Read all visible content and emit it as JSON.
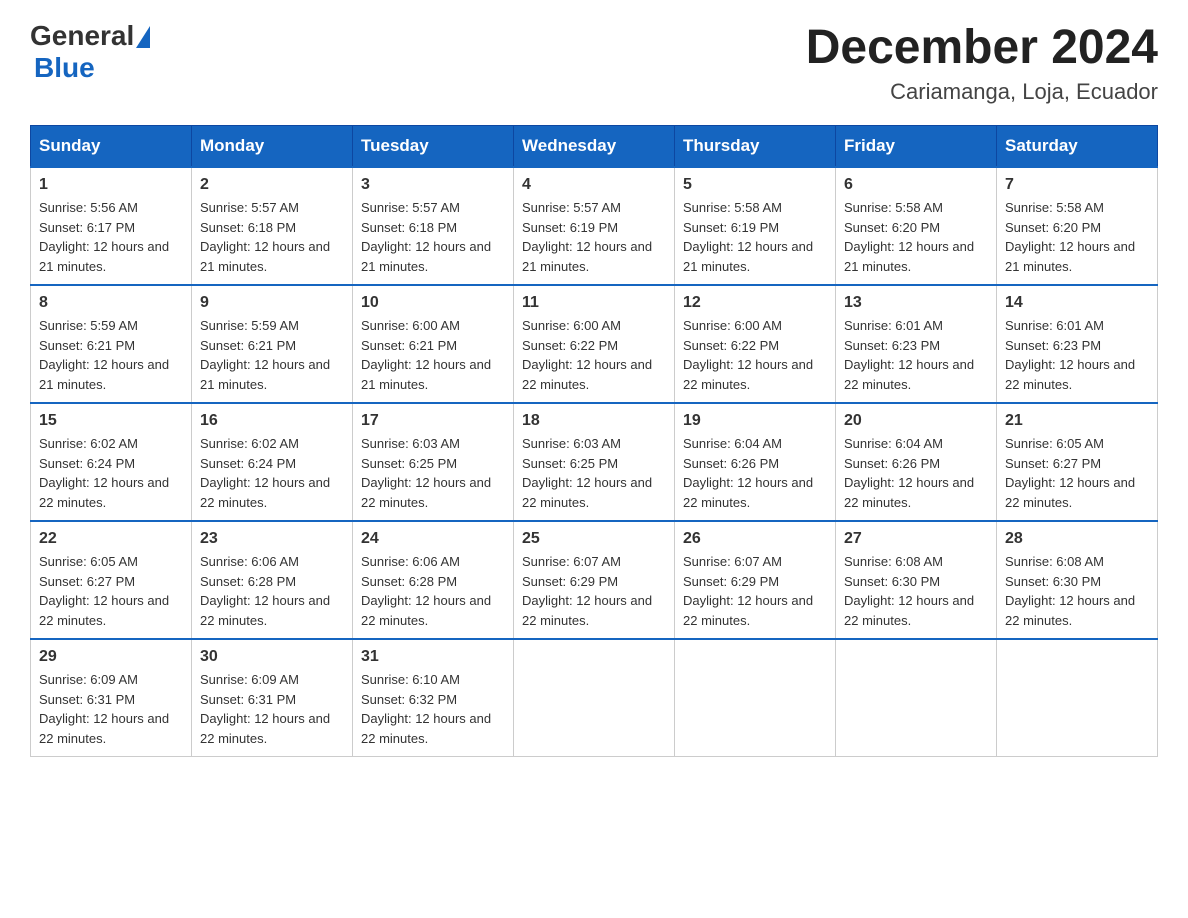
{
  "header": {
    "logo": {
      "general": "General",
      "blue": "Blue"
    },
    "title": "December 2024",
    "location": "Cariamanga, Loja, Ecuador"
  },
  "days_of_week": [
    "Sunday",
    "Monday",
    "Tuesday",
    "Wednesday",
    "Thursday",
    "Friday",
    "Saturday"
  ],
  "weeks": [
    [
      {
        "day": "1",
        "sunrise": "Sunrise: 5:56 AM",
        "sunset": "Sunset: 6:17 PM",
        "daylight": "Daylight: 12 hours and 21 minutes."
      },
      {
        "day": "2",
        "sunrise": "Sunrise: 5:57 AM",
        "sunset": "Sunset: 6:18 PM",
        "daylight": "Daylight: 12 hours and 21 minutes."
      },
      {
        "day": "3",
        "sunrise": "Sunrise: 5:57 AM",
        "sunset": "Sunset: 6:18 PM",
        "daylight": "Daylight: 12 hours and 21 minutes."
      },
      {
        "day": "4",
        "sunrise": "Sunrise: 5:57 AM",
        "sunset": "Sunset: 6:19 PM",
        "daylight": "Daylight: 12 hours and 21 minutes."
      },
      {
        "day": "5",
        "sunrise": "Sunrise: 5:58 AM",
        "sunset": "Sunset: 6:19 PM",
        "daylight": "Daylight: 12 hours and 21 minutes."
      },
      {
        "day": "6",
        "sunrise": "Sunrise: 5:58 AM",
        "sunset": "Sunset: 6:20 PM",
        "daylight": "Daylight: 12 hours and 21 minutes."
      },
      {
        "day": "7",
        "sunrise": "Sunrise: 5:58 AM",
        "sunset": "Sunset: 6:20 PM",
        "daylight": "Daylight: 12 hours and 21 minutes."
      }
    ],
    [
      {
        "day": "8",
        "sunrise": "Sunrise: 5:59 AM",
        "sunset": "Sunset: 6:21 PM",
        "daylight": "Daylight: 12 hours and 21 minutes."
      },
      {
        "day": "9",
        "sunrise": "Sunrise: 5:59 AM",
        "sunset": "Sunset: 6:21 PM",
        "daylight": "Daylight: 12 hours and 21 minutes."
      },
      {
        "day": "10",
        "sunrise": "Sunrise: 6:00 AM",
        "sunset": "Sunset: 6:21 PM",
        "daylight": "Daylight: 12 hours and 21 minutes."
      },
      {
        "day": "11",
        "sunrise": "Sunrise: 6:00 AM",
        "sunset": "Sunset: 6:22 PM",
        "daylight": "Daylight: 12 hours and 22 minutes."
      },
      {
        "day": "12",
        "sunrise": "Sunrise: 6:00 AM",
        "sunset": "Sunset: 6:22 PM",
        "daylight": "Daylight: 12 hours and 22 minutes."
      },
      {
        "day": "13",
        "sunrise": "Sunrise: 6:01 AM",
        "sunset": "Sunset: 6:23 PM",
        "daylight": "Daylight: 12 hours and 22 minutes."
      },
      {
        "day": "14",
        "sunrise": "Sunrise: 6:01 AM",
        "sunset": "Sunset: 6:23 PM",
        "daylight": "Daylight: 12 hours and 22 minutes."
      }
    ],
    [
      {
        "day": "15",
        "sunrise": "Sunrise: 6:02 AM",
        "sunset": "Sunset: 6:24 PM",
        "daylight": "Daylight: 12 hours and 22 minutes."
      },
      {
        "day": "16",
        "sunrise": "Sunrise: 6:02 AM",
        "sunset": "Sunset: 6:24 PM",
        "daylight": "Daylight: 12 hours and 22 minutes."
      },
      {
        "day": "17",
        "sunrise": "Sunrise: 6:03 AM",
        "sunset": "Sunset: 6:25 PM",
        "daylight": "Daylight: 12 hours and 22 minutes."
      },
      {
        "day": "18",
        "sunrise": "Sunrise: 6:03 AM",
        "sunset": "Sunset: 6:25 PM",
        "daylight": "Daylight: 12 hours and 22 minutes."
      },
      {
        "day": "19",
        "sunrise": "Sunrise: 6:04 AM",
        "sunset": "Sunset: 6:26 PM",
        "daylight": "Daylight: 12 hours and 22 minutes."
      },
      {
        "day": "20",
        "sunrise": "Sunrise: 6:04 AM",
        "sunset": "Sunset: 6:26 PM",
        "daylight": "Daylight: 12 hours and 22 minutes."
      },
      {
        "day": "21",
        "sunrise": "Sunrise: 6:05 AM",
        "sunset": "Sunset: 6:27 PM",
        "daylight": "Daylight: 12 hours and 22 minutes."
      }
    ],
    [
      {
        "day": "22",
        "sunrise": "Sunrise: 6:05 AM",
        "sunset": "Sunset: 6:27 PM",
        "daylight": "Daylight: 12 hours and 22 minutes."
      },
      {
        "day": "23",
        "sunrise": "Sunrise: 6:06 AM",
        "sunset": "Sunset: 6:28 PM",
        "daylight": "Daylight: 12 hours and 22 minutes."
      },
      {
        "day": "24",
        "sunrise": "Sunrise: 6:06 AM",
        "sunset": "Sunset: 6:28 PM",
        "daylight": "Daylight: 12 hours and 22 minutes."
      },
      {
        "day": "25",
        "sunrise": "Sunrise: 6:07 AM",
        "sunset": "Sunset: 6:29 PM",
        "daylight": "Daylight: 12 hours and 22 minutes."
      },
      {
        "day": "26",
        "sunrise": "Sunrise: 6:07 AM",
        "sunset": "Sunset: 6:29 PM",
        "daylight": "Daylight: 12 hours and 22 minutes."
      },
      {
        "day": "27",
        "sunrise": "Sunrise: 6:08 AM",
        "sunset": "Sunset: 6:30 PM",
        "daylight": "Daylight: 12 hours and 22 minutes."
      },
      {
        "day": "28",
        "sunrise": "Sunrise: 6:08 AM",
        "sunset": "Sunset: 6:30 PM",
        "daylight": "Daylight: 12 hours and 22 minutes."
      }
    ],
    [
      {
        "day": "29",
        "sunrise": "Sunrise: 6:09 AM",
        "sunset": "Sunset: 6:31 PM",
        "daylight": "Daylight: 12 hours and 22 minutes."
      },
      {
        "day": "30",
        "sunrise": "Sunrise: 6:09 AM",
        "sunset": "Sunset: 6:31 PM",
        "daylight": "Daylight: 12 hours and 22 minutes."
      },
      {
        "day": "31",
        "sunrise": "Sunrise: 6:10 AM",
        "sunset": "Sunset: 6:32 PM",
        "daylight": "Daylight: 12 hours and 22 minutes."
      },
      null,
      null,
      null,
      null
    ]
  ]
}
